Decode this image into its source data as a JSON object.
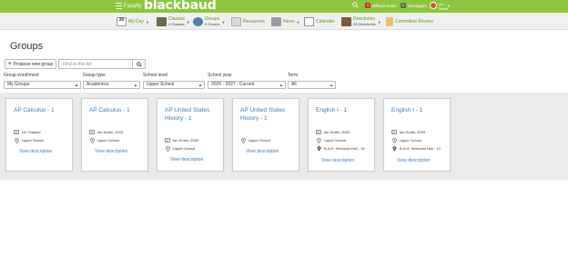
{
  "topbar": {
    "persona": "Faculty",
    "logo": "blackbaud",
    "notif_count": "4",
    "notif_label": "Official Notes",
    "msg_count": "0",
    "msg_label": "Messages",
    "user_line1": "Ian",
    "user_line2": "Smith"
  },
  "nav": {
    "my_day_num": "30",
    "my_day": "My Day",
    "classes": "Classes",
    "classes_count": "4 Classes",
    "groups": "Groups",
    "groups_count": "6 Groups",
    "resources": "Resources",
    "news": "News",
    "calendar": "Calendar",
    "directories": "Directories",
    "directories_count": "28 Directories",
    "committee": "Committee Review"
  },
  "page": {
    "title": "Groups"
  },
  "actions": {
    "propose": "Propose new group",
    "find_placeholder": "Find in this list"
  },
  "filters": [
    {
      "label": "Group enrollment",
      "value": "My Groups"
    },
    {
      "label": "Group type",
      "value": "Academics"
    },
    {
      "label": "School level",
      "value": "Upper School"
    },
    {
      "label": "School year",
      "value": "2026 - 2027 : Current"
    },
    {
      "label": "Term",
      "value": "All"
    }
  ],
  "cards": [
    {
      "title_1": "AP Calculus - 1",
      "title_2": "",
      "teacher": "UX Teacher",
      "school": "Upper School",
      "room": "",
      "link": "View description"
    },
    {
      "title_1": "AP Calculus - 1",
      "title_2": "",
      "teacher": "Ian Smith, 2003",
      "school": "Upper School",
      "room": "",
      "link": "View description"
    },
    {
      "title_1": "AP United States",
      "title_2": "History - 1",
      "teacher": "Ian Smith, 2003",
      "school": "Upper School",
      "room": "",
      "link": "View description"
    },
    {
      "title_1": "AP United States",
      "title_2": "History - 1",
      "teacher": "",
      "school": "Upper School",
      "room": "",
      "link": "View description"
    },
    {
      "title_1": "English I - 1",
      "title_2": "",
      "teacher": "Ian Smith, 2003",
      "school": "Upper School",
      "room": "B.A.H. Hemorial Hall - 30",
      "link": "View description"
    },
    {
      "title_1": "English I - 1",
      "title_2": "",
      "teacher": "Ian Smith, 2003",
      "school": "Upper School",
      "room": "B.A.H. Hemorial Hall - 10",
      "link": "View description"
    }
  ],
  "colors": {
    "brand_green": "#8cc63f",
    "link_blue": "#3a7bb5",
    "badge_red": "#d9312b"
  },
  "icons": {
    "teacher": "teacher-icon",
    "school": "location-pin-icon",
    "room": "room-pin-icon"
  }
}
